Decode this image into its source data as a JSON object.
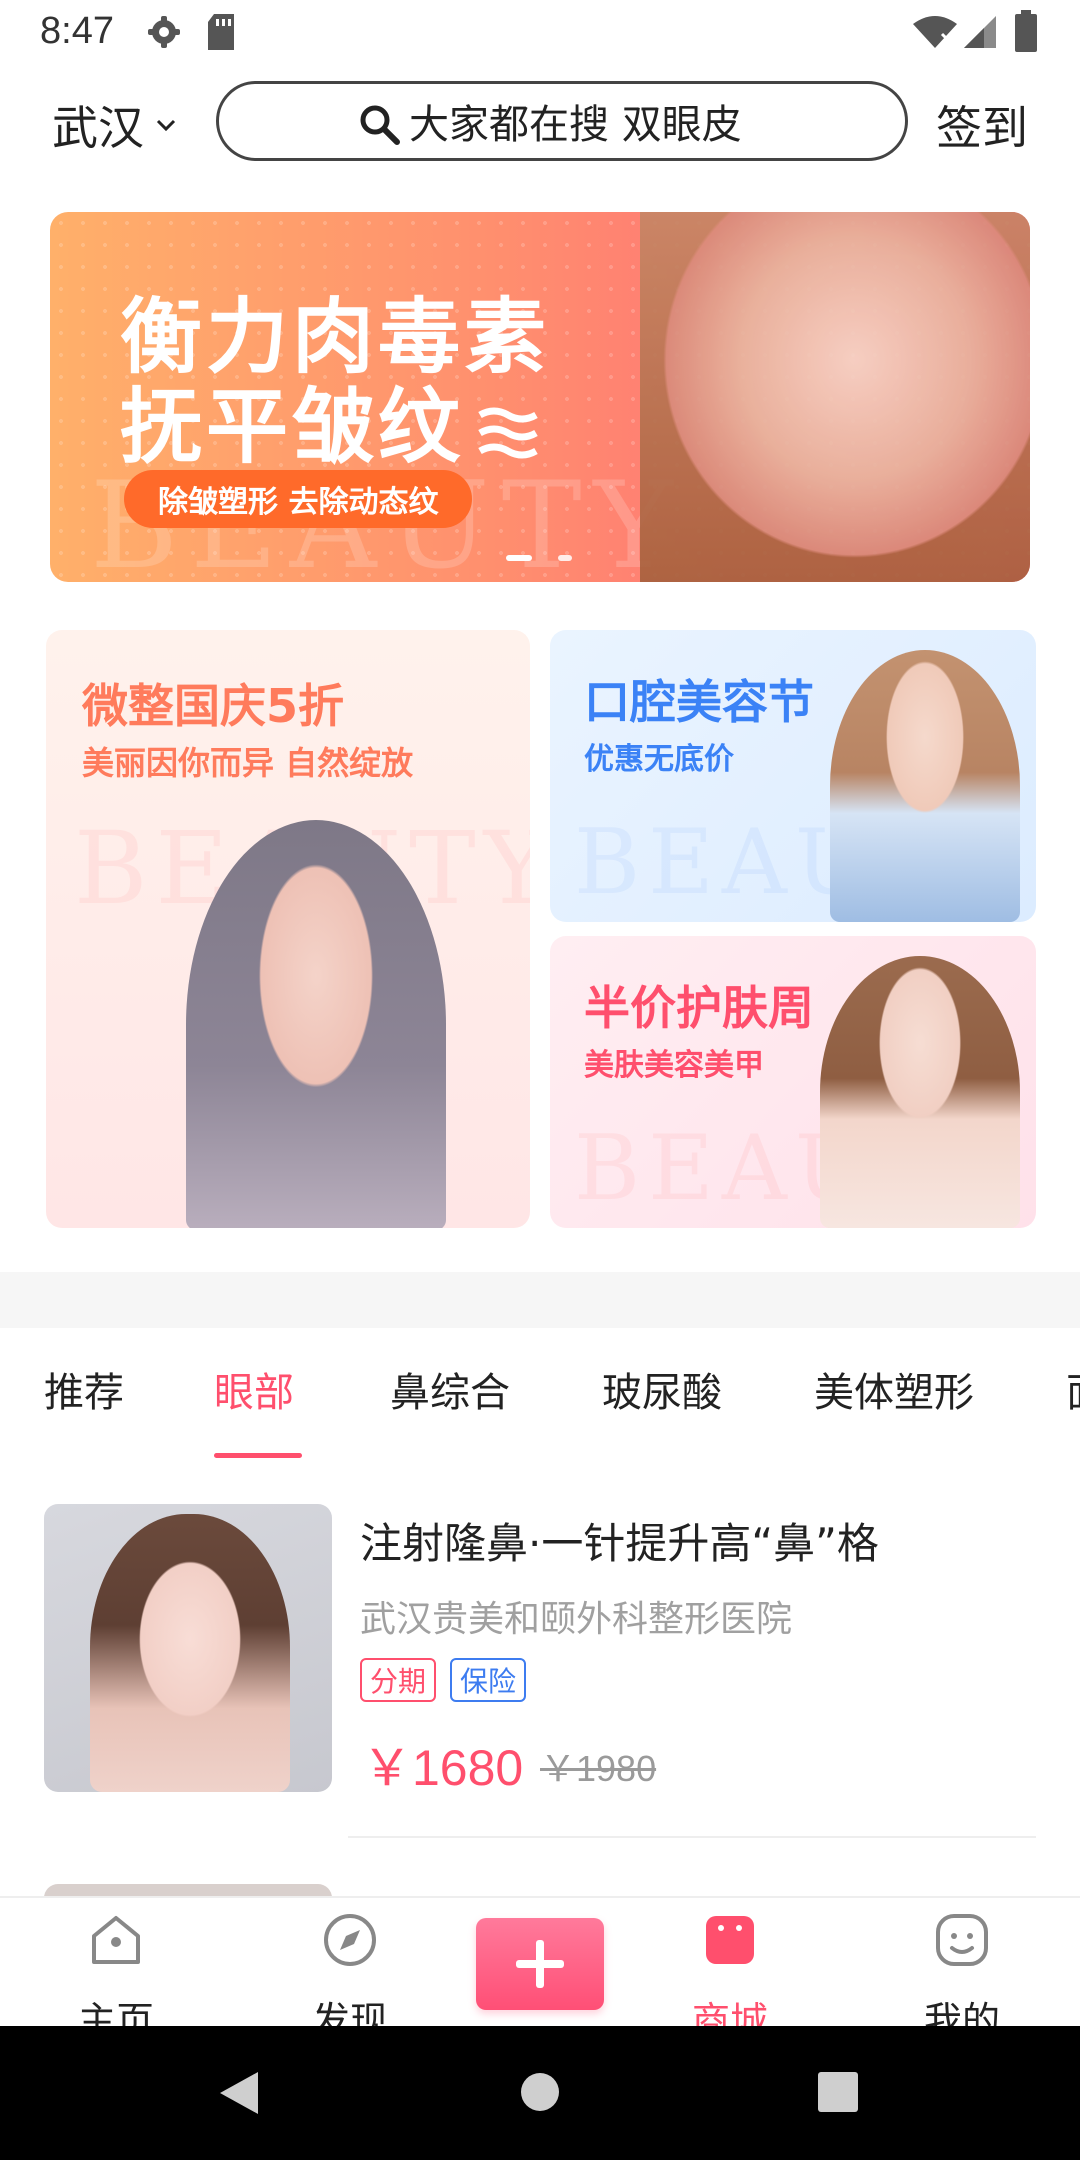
{
  "status_bar": {
    "time": "8:47",
    "left_icons": [
      "gear-icon",
      "sd-card-icon"
    ],
    "right_icons": [
      "wifi-icon",
      "signal-icon",
      "battery-icon"
    ]
  },
  "header": {
    "city": "武汉",
    "search_placeholder": "大家都在搜  双眼皮",
    "signin_label": "签到"
  },
  "banner": {
    "title_line1": "衡力肉毒素",
    "title_line2": "抚平皱纹",
    "pill_text": "除皱塑形  去除动态纹",
    "background_word": "BEAUTY",
    "active_index": 0,
    "page_count": 2
  },
  "promos": [
    {
      "title": "微整国庆5折",
      "subtitle": "美丽因你而异 自然绽放",
      "background_word": "BEAUTY",
      "title_color": "#ff7b5c",
      "subtitle_color": "#ff7b5c"
    },
    {
      "title": "口腔美容节",
      "subtitle": "优惠无底价",
      "background_word": "BEAUTY",
      "title_color": "#3b82f6",
      "subtitle_color": "#3b82f6"
    },
    {
      "title": "半价护肤周",
      "subtitle": "美肤美容美甲",
      "background_word": "BEAUTY",
      "title_color": "#ff4f6d",
      "subtitle_color": "#ff4f6d"
    }
  ],
  "category_tabs": {
    "items": [
      "推荐",
      "眼部",
      "鼻综合",
      "玻尿酸",
      "美体塑形",
      "面"
    ],
    "active_index": 1,
    "active_color": "#ff4f6d"
  },
  "product": {
    "title": "注射隆鼻·一针提升高“鼻”格",
    "shop": "武汉贵美和颐外科整形医院",
    "tags": [
      "分期",
      "保险"
    ],
    "price": "￥1680",
    "original_price": "￥1980"
  },
  "bottom_nav": {
    "items": [
      "主页",
      "发现",
      "商城",
      "我的"
    ],
    "active_index": 2,
    "center_button": "+"
  },
  "colors": {
    "accent": "#ff4f6d",
    "blue": "#3d7cf0"
  }
}
